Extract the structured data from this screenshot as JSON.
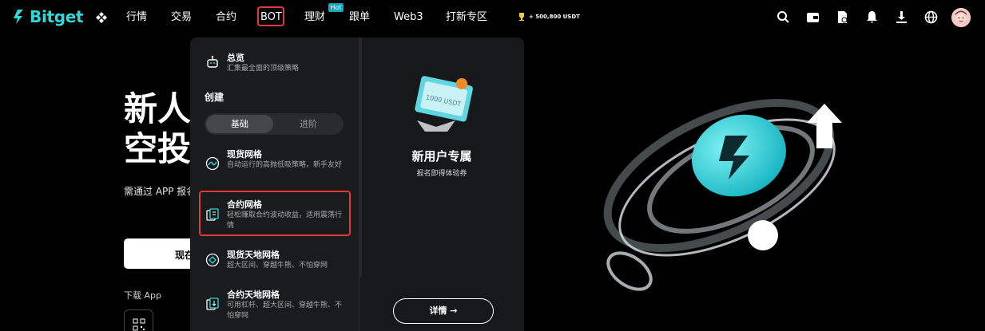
{
  "brand": {
    "name": "Bitget",
    "accent": "#2dd9d9"
  },
  "nav": {
    "items": [
      {
        "label": "行情",
        "key": "market"
      },
      {
        "label": "交易",
        "key": "trade"
      },
      {
        "label": "合约",
        "key": "futures"
      },
      {
        "label": "BOT",
        "key": "bot",
        "highlighted": true
      },
      {
        "label": "理财",
        "key": "earn",
        "badge": "Hot"
      },
      {
        "label": "跟单",
        "key": "copy"
      },
      {
        "label": "Web3",
        "key": "web3"
      },
      {
        "label": "打新专区",
        "key": "launch"
      }
    ],
    "reward": "+ 500,800 USDT",
    "icons": [
      "search-icon",
      "wallet-icon",
      "orders-icon",
      "notification-icon",
      "download-icon",
      "language-icon"
    ]
  },
  "hero": {
    "title_line1": "新人",
    "title_line2": "空投",
    "subtitle": "需通过 APP 报名",
    "cta": "现在",
    "download_label": "下载 App"
  },
  "dropdown": {
    "overview": {
      "title": "总览",
      "desc": "汇集最全面的顶级策略"
    },
    "create_label": "创建",
    "segment": {
      "active": "基础",
      "inactive": "进阶"
    },
    "items": [
      {
        "title": "现货网格",
        "desc": "自动运行的高抛低吸策略，新手友好"
      },
      {
        "title": "合约网格",
        "desc": "轻松赚取合约波动收益，适用震荡行情",
        "highlighted": true
      },
      {
        "title": "现货天地网格",
        "desc": "超大区间、穿越牛熊、不怕穿网"
      },
      {
        "title": "合约天地网格",
        "desc": "可用杠杆、超大区间、穿越牛熊、不怕穿网"
      }
    ],
    "promo": {
      "ticket_text": "1000 USDT",
      "title": "新用户专属",
      "subtitle": "报名即得体验券",
      "button": "详情 →"
    }
  },
  "colors": {
    "highlight": "#e23a3a",
    "panel": "#17181a",
    "hot_badge": "#14a7c2"
  }
}
